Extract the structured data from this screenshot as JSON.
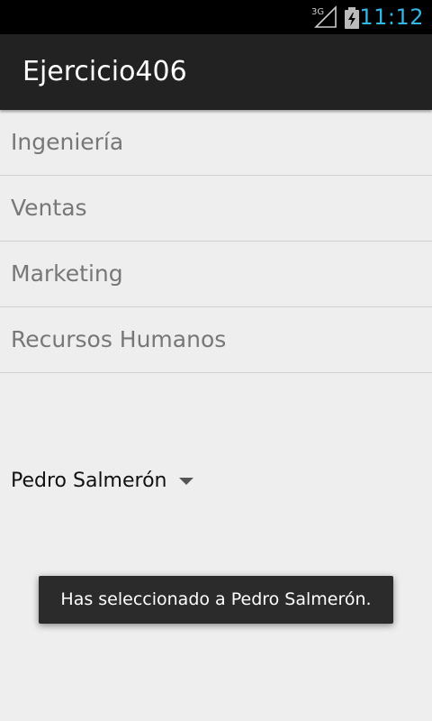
{
  "status_bar": {
    "network_label": "3G",
    "clock": "11:12",
    "accent_color": "#33b5e5",
    "icons": [
      "signal-icon",
      "battery-charging-icon"
    ]
  },
  "action_bar": {
    "title": "Ejercicio406"
  },
  "list": {
    "items": [
      {
        "label": "Ingeniería"
      },
      {
        "label": "Ventas"
      },
      {
        "label": "Marketing"
      },
      {
        "label": "Recursos Humanos"
      }
    ]
  },
  "spinner": {
    "selected_value": "Pedro Salmerón"
  },
  "toast": {
    "message": "Has seleccionado a Pedro Salmerón."
  }
}
